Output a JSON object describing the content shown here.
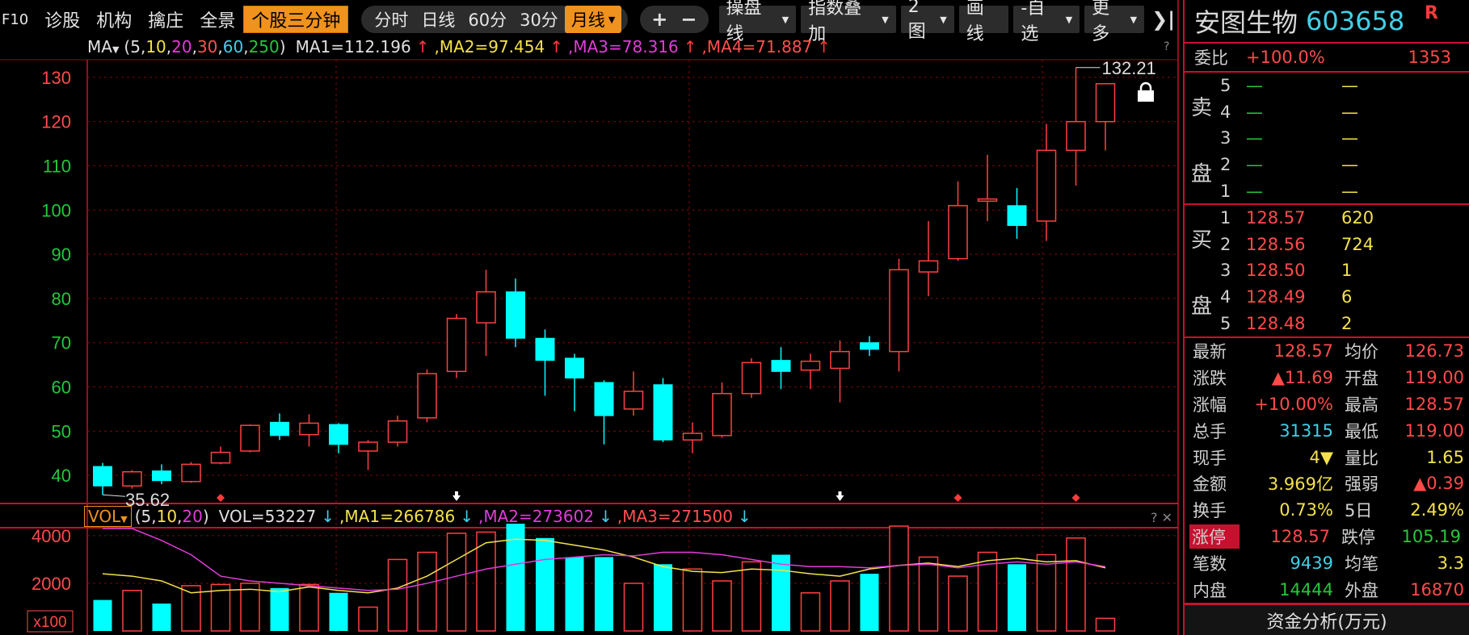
{
  "toolbar": {
    "items": [
      "F10",
      "诊股",
      "机构",
      "擒庄",
      "全景"
    ],
    "highlight": "个股三分钟",
    "periods": [
      "分时",
      "日线",
      "60分",
      "30分",
      "月线"
    ],
    "active_period": "月线",
    "zoom_in": "+",
    "zoom_out": "−",
    "menus": [
      "操盘线",
      "指数叠加",
      "2图",
      "画线",
      "-自选",
      "更多"
    ],
    "close": "❯|"
  },
  "ma_header": {
    "prefix": "MA",
    "params": [
      "5",
      "10",
      "20",
      "30",
      "60",
      "250"
    ],
    "ma1": "MA1=112.196",
    "ma2": "MA2=97.454",
    "ma3": "MA3=78.316",
    "ma4": "MA4=71.887",
    "help": "?"
  },
  "vol_header": {
    "selector": "VOL",
    "params": [
      "5",
      "10",
      "20"
    ],
    "vol": "VOL=53227",
    "ma1": "MA1=266786",
    "ma2": "MA2=273602",
    "ma3": "MA3=271500",
    "controls": "? ✕"
  },
  "colors": {
    "up": "#ff4040",
    "down": "#00ffff",
    "ma1": "#e0e0e0",
    "ma2": "#f5e24a",
    "ma3": "#e23cd8",
    "grid": "#7a0a0a"
  },
  "chart_data": [
    {
      "type": "candlestick",
      "title": "",
      "price_axis": {
        "ticks": [
          40,
          50,
          60,
          70,
          80,
          90,
          100,
          110,
          120,
          130
        ],
        "range": [
          34,
          134
        ]
      },
      "annotations": {
        "high_label": "132.21",
        "low_label": "35.62"
      },
      "candles": [
        {
          "o": 42.0,
          "h": 42.8,
          "l": 35.6,
          "c": 37.6
        },
        {
          "o": 37.6,
          "h": 41.2,
          "l": 37.0,
          "c": 40.8
        },
        {
          "o": 41.0,
          "h": 42.5,
          "l": 38.0,
          "c": 38.8
        },
        {
          "o": 38.6,
          "h": 43.0,
          "l": 38.3,
          "c": 42.5
        },
        {
          "o": 42.8,
          "h": 46.5,
          "l": 42.5,
          "c": 45.2
        },
        {
          "o": 45.5,
          "h": 51.5,
          "l": 45.2,
          "c": 51.3
        },
        {
          "o": 52.0,
          "h": 54.0,
          "l": 48.0,
          "c": 49.0
        },
        {
          "o": 49.2,
          "h": 53.8,
          "l": 46.5,
          "c": 51.8
        },
        {
          "o": 51.5,
          "h": 51.8,
          "l": 45.0,
          "c": 47.0
        },
        {
          "o": 45.5,
          "h": 48.0,
          "l": 41.2,
          "c": 47.5
        },
        {
          "o": 47.5,
          "h": 53.5,
          "l": 46.5,
          "c": 52.3
        },
        {
          "o": 53.0,
          "h": 64.0,
          "l": 52.0,
          "c": 63.0
        },
        {
          "o": 63.5,
          "h": 76.5,
          "l": 62.0,
          "c": 75.5
        },
        {
          "o": 74.5,
          "h": 86.5,
          "l": 67.0,
          "c": 81.5
        },
        {
          "o": 81.5,
          "h": 84.5,
          "l": 69.0,
          "c": 71.0
        },
        {
          "o": 71.0,
          "h": 73.0,
          "l": 58.0,
          "c": 66.0
        },
        {
          "o": 66.5,
          "h": 67.5,
          "l": 54.5,
          "c": 62.0
        },
        {
          "o": 61.0,
          "h": 61.5,
          "l": 47.0,
          "c": 53.5
        },
        {
          "o": 55.0,
          "h": 63.5,
          "l": 53.5,
          "c": 59.0
        },
        {
          "o": 60.5,
          "h": 62.0,
          "l": 47.5,
          "c": 48.0
        },
        {
          "o": 48.0,
          "h": 52.0,
          "l": 45.0,
          "c": 49.5
        },
        {
          "o": 49.0,
          "h": 61.0,
          "l": 48.5,
          "c": 58.5
        },
        {
          "o": 58.5,
          "h": 66.5,
          "l": 57.5,
          "c": 65.5
        },
        {
          "o": 66.0,
          "h": 69.0,
          "l": 59.5,
          "c": 63.5
        },
        {
          "o": 63.8,
          "h": 67.5,
          "l": 59.5,
          "c": 65.8
        },
        {
          "o": 64.2,
          "h": 70.5,
          "l": 56.5,
          "c": 68.0
        },
        {
          "o": 70.0,
          "h": 71.5,
          "l": 67.0,
          "c": 68.5
        },
        {
          "o": 68.0,
          "h": 89.0,
          "l": 63.5,
          "c": 86.5
        },
        {
          "o": 86.0,
          "h": 97.5,
          "l": 80.5,
          "c": 88.5
        },
        {
          "o": 89.0,
          "h": 106.5,
          "l": 88.5,
          "c": 101.0
        },
        {
          "o": 102.0,
          "h": 112.5,
          "l": 97.5,
          "c": 102.5
        },
        {
          "o": 101.0,
          "h": 105.0,
          "l": 93.5,
          "c": 96.5
        },
        {
          "o": 97.5,
          "h": 119.5,
          "l": 93.0,
          "c": 113.5
        },
        {
          "o": 113.5,
          "h": 132.21,
          "l": 105.5,
          "c": 120.0
        },
        {
          "o": 120.0,
          "h": 128.57,
          "l": 113.5,
          "c": 128.57
        }
      ]
    },
    {
      "type": "bar",
      "title": "",
      "y_ticks": [
        2000,
        4000
      ],
      "unit_label": "x100",
      "range": [
        0,
        4300
      ],
      "values": [
        1300,
        1700,
        1150,
        1900,
        1950,
        2000,
        1800,
        1950,
        1600,
        1000,
        3000,
        3300,
        4100,
        4150,
        4500,
        3900,
        3100,
        3100,
        2000,
        2800,
        2600,
        2100,
        2900,
        3200,
        1600,
        2100,
        2400,
        4400,
        3100,
        2300,
        3300,
        2800,
        3200,
        3900,
        530
      ],
      "ma5": [
        2400,
        2300,
        2100,
        1600,
        1700,
        1750,
        1650,
        1850,
        1700,
        1600,
        1800,
        2300,
        3000,
        3700,
        3850,
        3800,
        3600,
        3400,
        3100,
        2700,
        2500,
        2450,
        2600,
        2550,
        2400,
        2300,
        2600,
        2750,
        2850,
        2700,
        2950,
        3050,
        2900,
        2950,
        2650
      ],
      "ma10": [
        5000,
        4600,
        3800,
        3200,
        2300,
        2100,
        2000,
        1900,
        1800,
        1700,
        1750,
        2000,
        2300,
        2600,
        2800,
        3000,
        3100,
        3200,
        3150,
        3300,
        3300,
        3200,
        3000,
        2800,
        2700,
        2700,
        2650,
        2750,
        2800,
        2650,
        2800,
        2900,
        2800,
        2900,
        2700
      ]
    }
  ],
  "x_markers": {
    "red_diamonds_at": [
      4,
      29,
      33
    ],
    "white_arrows_at": [
      12,
      25
    ]
  },
  "panel": {
    "name": "安图生物",
    "code": "603658",
    "badge": "R",
    "weibi_label": "委比",
    "weibi_pct": "+100.0%",
    "weibi_count": "1353",
    "sell_label": [
      "卖",
      "盘"
    ],
    "buy_label": [
      "买",
      "盘"
    ],
    "sell": [
      {
        "lv": "5",
        "p": "—",
        "v": "—"
      },
      {
        "lv": "4",
        "p": "—",
        "v": "—"
      },
      {
        "lv": "3",
        "p": "—",
        "v": "—"
      },
      {
        "lv": "2",
        "p": "—",
        "v": "—"
      },
      {
        "lv": "1",
        "p": "—",
        "v": "—"
      }
    ],
    "buy": [
      {
        "lv": "1",
        "p": "128.57",
        "v": "620"
      },
      {
        "lv": "2",
        "p": "128.56",
        "v": "724"
      },
      {
        "lv": "3",
        "p": "128.50",
        "v": "1"
      },
      {
        "lv": "4",
        "p": "128.49",
        "v": "6"
      },
      {
        "lv": "5",
        "p": "128.48",
        "v": "2"
      }
    ],
    "stats": [
      {
        "k": "最新",
        "v": "128.57",
        "vc": "red",
        "k2": "均价",
        "v2": "126.73",
        "v2c": "red"
      },
      {
        "k": "涨跌",
        "v": "▲11.69",
        "vc": "red",
        "k2": "开盘",
        "v2": "119.00",
        "v2c": "red"
      },
      {
        "k": "涨幅",
        "v": "+10.00%",
        "vc": "red",
        "k2": "最高",
        "v2": "128.57",
        "v2c": "red"
      },
      {
        "k": "总手",
        "v": "31315",
        "vc": "cyn",
        "k2": "最低",
        "v2": "119.00",
        "v2c": "red"
      },
      {
        "k": "现手",
        "v": "4▼",
        "vc": "yel",
        "k2": "量比",
        "v2": "1.65",
        "v2c": "yel"
      },
      {
        "k": "金额",
        "v": "3.969亿",
        "vc": "yel",
        "k2": "强弱",
        "v2": "▲0.39",
        "v2c": "red"
      },
      {
        "k": "换手",
        "v": "0.73%",
        "vc": "yel",
        "k2": "5日",
        "v2": "2.49%",
        "v2c": "yel"
      },
      {
        "k": "涨停",
        "v": "128.57",
        "vc": "red",
        "k2": "跌停",
        "v2": "105.19",
        "v2c": "grn"
      },
      {
        "k": "笔数",
        "v": "9439",
        "vc": "cyn",
        "k2": "均笔",
        "v2": "3.3",
        "v2c": "yel"
      },
      {
        "k": "内盘",
        "v": "14444",
        "vc": "grn",
        "k2": "外盘",
        "v2": "16870",
        "v2c": "red"
      }
    ],
    "fund_title": "资金分析(万元)"
  }
}
